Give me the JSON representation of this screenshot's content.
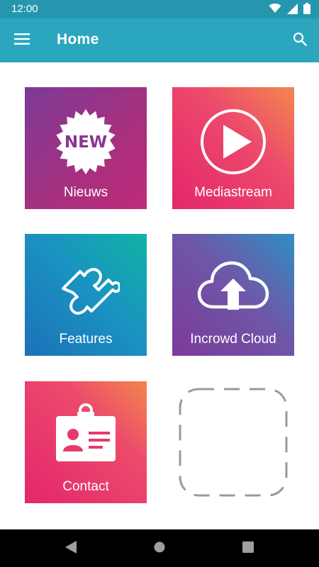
{
  "status_bar": {
    "time": "12:00",
    "icons": [
      "wifi-icon",
      "signal-icon",
      "battery-icon"
    ]
  },
  "app_bar": {
    "title": "Home",
    "menu_icon": "hamburger-menu-icon",
    "search_icon": "search-icon",
    "color": "#2aa7bf"
  },
  "tiles": [
    {
      "label": "Nieuws",
      "icon": "new-badge-icon",
      "badge_text": "NEW"
    },
    {
      "label": "Mediastream",
      "icon": "play-icon"
    },
    {
      "label": "Features",
      "icon": "puzzle-piece-icon"
    },
    {
      "label": "Incrowd Cloud",
      "icon": "cloud-upload-icon"
    },
    {
      "label": "Contact",
      "icon": "contact-card-icon"
    }
  ],
  "placeholder": {
    "icon": "add-tile-placeholder"
  },
  "nav_bar": {
    "icons": [
      "back-icon",
      "home-icon",
      "recents-icon"
    ]
  }
}
